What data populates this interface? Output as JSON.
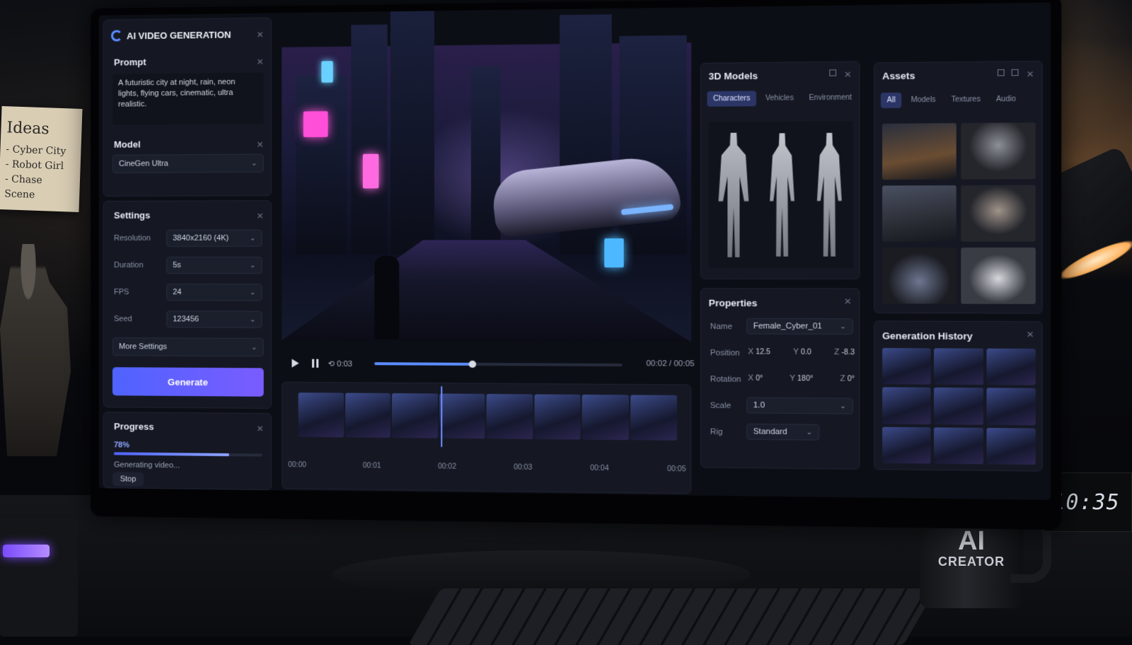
{
  "app": {
    "title": "AI VIDEO GENERATION"
  },
  "prompt": {
    "title": "Prompt",
    "text": "A futuristic city at night, rain, neon lights, flying cars, cinematic, ultra realistic."
  },
  "model": {
    "title": "Model",
    "selected": "CineGen Ultra"
  },
  "settings": {
    "title": "Settings",
    "resolution_label": "Resolution",
    "resolution": "3840x2160 (4K)",
    "duration_label": "Duration",
    "duration": "5s",
    "fps_label": "FPS",
    "fps": "24",
    "seed_label": "Seed",
    "seed": "123456",
    "more_label": "More Settings"
  },
  "generate_label": "Generate",
  "progress": {
    "title": "Progress",
    "percent_text": "78%",
    "percent": 0.78,
    "status": "Generating video...",
    "stop_label": "Stop"
  },
  "player": {
    "time": "00:02 / 00:05",
    "loop_label": "0:03",
    "progress": 0.4
  },
  "timeline": {
    "ticks": [
      "00:00",
      "00:01",
      "00:02",
      "00:03",
      "00:04",
      "00:05"
    ]
  },
  "models3d": {
    "title": "3D Models",
    "tabs": [
      "Characters",
      "Vehicles",
      "Environment"
    ],
    "active_tab": 0
  },
  "properties": {
    "title": "Properties",
    "name_label": "Name",
    "name": "Female_Cyber_01",
    "position_label": "Position",
    "pos_x": "12.5",
    "pos_y": "0.0",
    "pos_z": "-8.3",
    "rotation_label": "Rotation",
    "rot_x": "0°",
    "rot_y": "180°",
    "rot_z": "0°",
    "scale_label": "Scale",
    "scale": "1.0",
    "rig_label": "Rig",
    "rig": "Standard",
    "x_axis": "X",
    "y_axis": "Y",
    "z_axis": "Z"
  },
  "assets": {
    "title": "Assets",
    "tabs": [
      "All",
      "Models",
      "Textures",
      "Audio"
    ],
    "active_tab": 0
  },
  "history": {
    "title": "Generation History"
  },
  "desk": {
    "note_title": "Ideas",
    "note_items": [
      "- Cyber City",
      "- Robot Girl",
      "- Chase Scene"
    ],
    "mug_line1": "AI",
    "mug_line2": "CREATOR",
    "clock": "10:35"
  },
  "colors": {
    "accent": "#5b6cff",
    "accent2": "#7a5cff",
    "panel": "#151823",
    "bg": "#0c0e15"
  },
  "icons": [
    "logo-icon",
    "close-icon",
    "chevron-down-icon",
    "play-icon",
    "pause-icon",
    "loop-icon",
    "minimize-icon",
    "maximize-icon"
  ]
}
